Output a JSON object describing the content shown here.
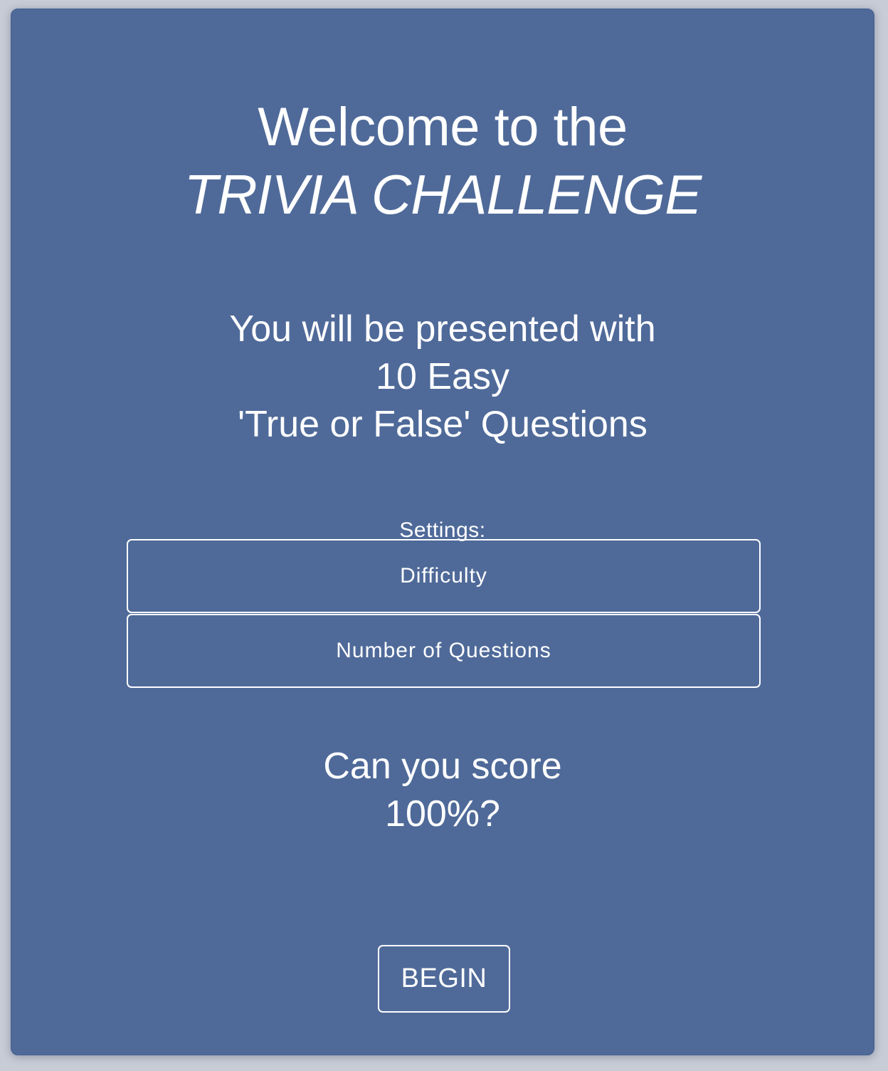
{
  "welcome": {
    "line1": "Welcome to the",
    "line2": "TRIVIA CHALLENGE"
  },
  "intro": {
    "line1": "You will be presented with",
    "line2": "10 Easy",
    "line3": "'True or False' Questions"
  },
  "settings": {
    "label": "Settings:",
    "difficulty_label": "Difficulty",
    "number_label": "Number of Questions"
  },
  "challenge": {
    "line1": "Can you score",
    "line2": "100%?"
  },
  "actions": {
    "begin_label": "BEGIN"
  },
  "colors": {
    "card_background": "#4f6a99",
    "page_background": "#c8ccd6",
    "text": "#ffffff"
  }
}
